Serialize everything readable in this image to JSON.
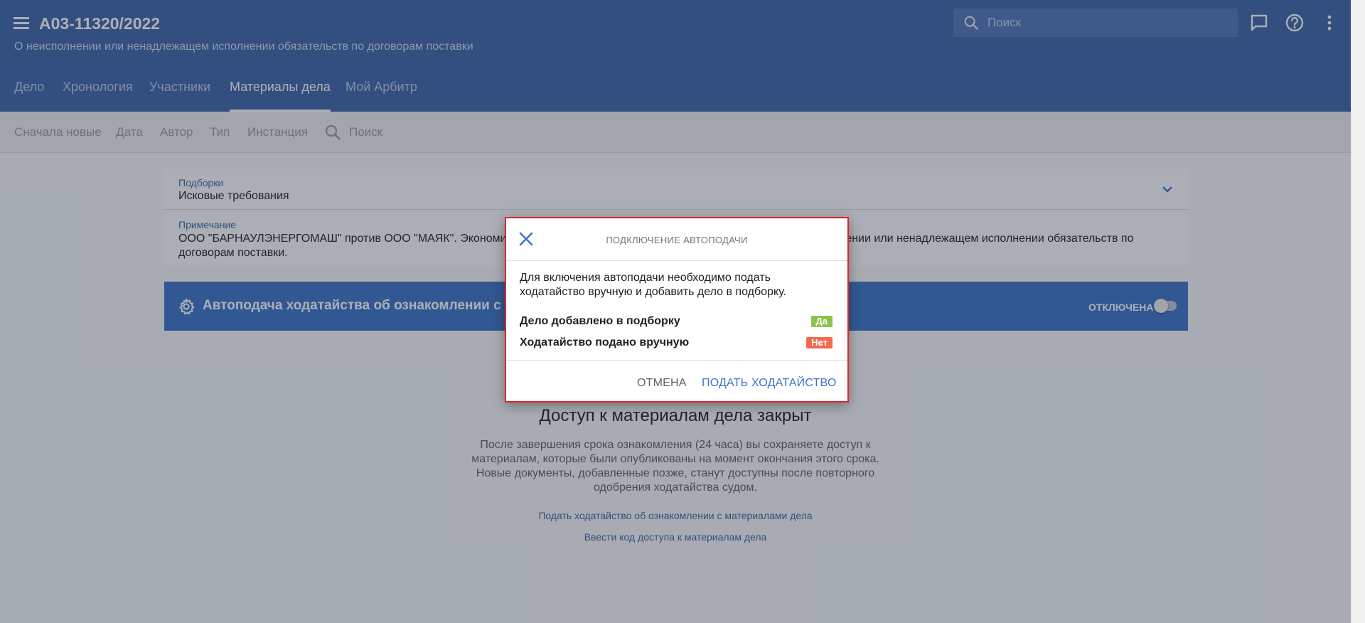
{
  "header": {
    "case_number": "А03-11320/2022",
    "case_subject": "О неисполнении или ненадлежащем исполнении обязательств по договорам поставки",
    "search_placeholder": "Поиск",
    "icons": [
      "menu-icon",
      "search-icon",
      "chat-icon",
      "help-icon",
      "more-vert-icon"
    ],
    "tabs": [
      {
        "label": "Дело",
        "active": false
      },
      {
        "label": "Хронология",
        "active": false
      },
      {
        "label": "Участники",
        "active": false
      },
      {
        "label": "Материалы дела",
        "active": true
      },
      {
        "label": "Мой Арбитр",
        "active": false
      }
    ]
  },
  "toolbar": {
    "filters": [
      "Сначала новые",
      "Дата",
      "Автор",
      "Тип",
      "Инстанция"
    ],
    "search_label": "Поиск"
  },
  "collection": {
    "label": "Подборки",
    "value": "Исковые требования"
  },
  "note": {
    "label": "Примечание",
    "text_start": "ООО \"БАРНАУЛЭНЕРГОМАШ\" против ООО \"МАЯК\". Экономи",
    "text_end": "нении или ненадлежащем исполнении обязательств по",
    "text_line2": "договорам поставки."
  },
  "banner": {
    "title": "Автоподача ходатайства об ознакомлении с ма",
    "status": "ОТКЛЮЧЕНА",
    "enabled": false
  },
  "access": {
    "title": "Доступ к материалам дела закрыт",
    "description": "После завершения срока ознакомления (24 часа) вы сохраняете доступ к материалам, которые были опубликованы на момент окончания этого срока. Новые документы, добавленные позже, станут доступны после повторного одобрения ходатайства судом.",
    "link_petition": "Подать ходатайство об ознакомлении с материалами дела",
    "link_code": "Ввести код доступа к материалам дела"
  },
  "dialog": {
    "title": "ПОДКЛЮЧЕНИЕ АВТОПОДАЧИ",
    "text": "Для включения автоподачи необходимо подать ходатайство вручную и добавить дело в подборку.",
    "rows": [
      {
        "label": "Дело добавлено в подборку",
        "badge": "Да"
      },
      {
        "label": "Ходатайство подано вручную",
        "badge": "Нет"
      }
    ],
    "cancel_label": "ОТМЕНА",
    "submit_label": "ПОДАТЬ ХОДАТАЙСТВО",
    "colors": {
      "yes": "#8bc34a",
      "no": "#f06a4d",
      "highlight_border": "#e02424"
    }
  },
  "colors": {
    "header": "#3d64a8",
    "banner": "#3b73c8",
    "accent": "#3b73c8"
  }
}
